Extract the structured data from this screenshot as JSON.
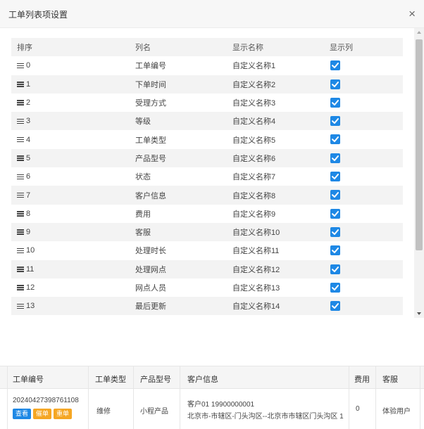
{
  "dialog": {
    "title": "工单列表项设置",
    "close_icon": "×"
  },
  "table": {
    "headers": {
      "sort": "排序",
      "column": "列名",
      "display_name": "显示名称",
      "show": "显示列"
    },
    "rows": [
      {
        "sort": "0",
        "column": "工单编号",
        "display_name": "自定义名称1",
        "checked": true
      },
      {
        "sort": "1",
        "column": "下单时间",
        "display_name": "自定义名称2",
        "checked": true
      },
      {
        "sort": "2",
        "column": "受理方式",
        "display_name": "自定义名称3",
        "checked": true
      },
      {
        "sort": "3",
        "column": "等级",
        "display_name": "自定义名称4",
        "checked": true
      },
      {
        "sort": "4",
        "column": "工单类型",
        "display_name": "自定义名称5",
        "checked": true
      },
      {
        "sort": "5",
        "column": "产品型号",
        "display_name": "自定义名称6",
        "checked": true
      },
      {
        "sort": "6",
        "column": "状态",
        "display_name": "自定义名称7",
        "checked": true
      },
      {
        "sort": "7",
        "column": "客户信息",
        "display_name": "自定义名称8",
        "checked": true
      },
      {
        "sort": "8",
        "column": "费用",
        "display_name": "自定义名称9",
        "checked": true
      },
      {
        "sort": "9",
        "column": "客服",
        "display_name": "自定义名称10",
        "checked": true
      },
      {
        "sort": "10",
        "column": "处理时长",
        "display_name": "自定义名称11",
        "checked": true
      },
      {
        "sort": "11",
        "column": "处理网点",
        "display_name": "自定义名称12",
        "checked": true
      },
      {
        "sort": "12",
        "column": "网点人员",
        "display_name": "自定义名称13",
        "checked": true
      },
      {
        "sort": "13",
        "column": "最后更新",
        "display_name": "自定义名称14",
        "checked": true
      }
    ]
  },
  "preview": {
    "headers": {
      "order_no": "工单编号",
      "order_type": "工单类型",
      "model": "产品型号",
      "customer": "客户信息",
      "fee": "费用",
      "service": "客服"
    },
    "row": {
      "order_no": "20240427398761108",
      "buttons": {
        "view": "查看",
        "urge": "催单",
        "resend": "重单"
      },
      "order_type": "维修",
      "model": "小程产品",
      "customer_line1": "客户01 19900000001",
      "customer_line2": "北京市-市辖区-门头沟区--北京市市辖区门头沟区 1",
      "fee": "0",
      "service": "体验用户"
    }
  },
  "colors": {
    "accent": "#1e88e5",
    "tag_orange": "#f5a623",
    "stripe": "#f3f3f3"
  }
}
